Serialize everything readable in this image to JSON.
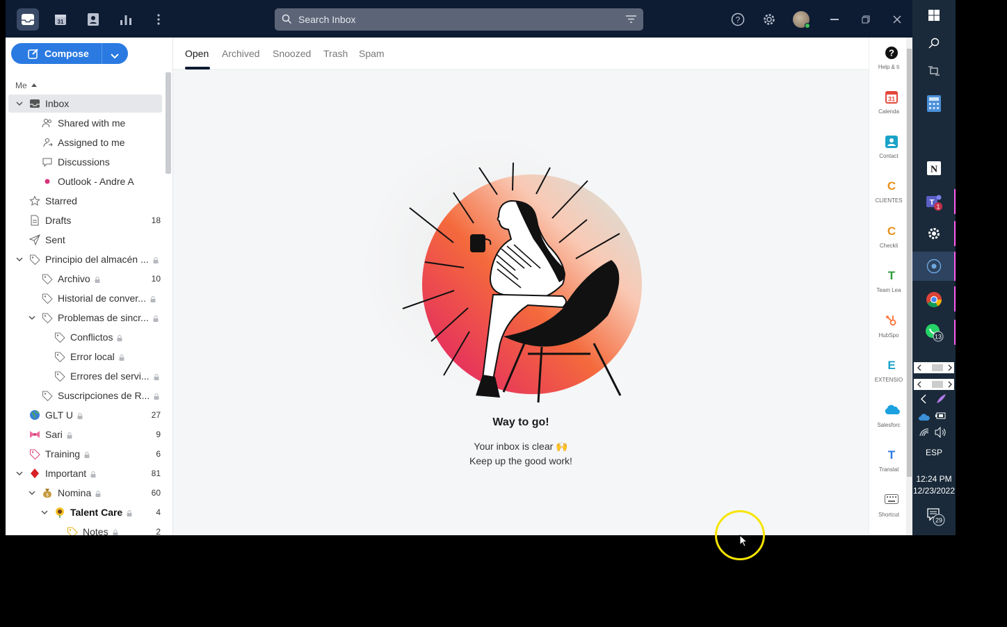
{
  "topbar": {
    "search_placeholder": "Search Inbox",
    "calendar_day": "31"
  },
  "compose": {
    "label": "Compose"
  },
  "nav": {
    "section": "Me",
    "items": [
      {
        "label": "Inbox",
        "count": ""
      },
      {
        "label": "Shared with me",
        "count": ""
      },
      {
        "label": "Assigned to me",
        "count": ""
      },
      {
        "label": "Discussions",
        "count": ""
      },
      {
        "label": "Outlook - Andre A",
        "count": ""
      },
      {
        "label": "Starred",
        "count": ""
      },
      {
        "label": "Drafts",
        "count": "18"
      },
      {
        "label": "Sent",
        "count": ""
      },
      {
        "label": "Principio del almacén ...",
        "count": ""
      },
      {
        "label": "Archivo",
        "count": "10"
      },
      {
        "label": "Historial de conver...",
        "count": ""
      },
      {
        "label": "Problemas de sincr...",
        "count": ""
      },
      {
        "label": "Conflictos",
        "count": ""
      },
      {
        "label": "Error local",
        "count": ""
      },
      {
        "label": "Errores del servi...",
        "count": ""
      },
      {
        "label": "Suscripciones de R...",
        "count": ""
      },
      {
        "label": "GLT U",
        "count": "27"
      },
      {
        "label": "Sari",
        "count": "9"
      },
      {
        "label": "Training",
        "count": "6"
      },
      {
        "label": "Important",
        "count": "81"
      },
      {
        "label": "Nomina",
        "count": "60"
      },
      {
        "label": "Talent Care",
        "count": "4"
      },
      {
        "label": "Notes",
        "count": "2"
      }
    ]
  },
  "tabs": [
    "Open",
    "Archived",
    "Snoozed",
    "Trash",
    "Spam"
  ],
  "empty_state": {
    "title": "Way to go!",
    "line1": "Your inbox is clear 🙌",
    "line2": "Keep up the good work!"
  },
  "right_apps": [
    {
      "label": "Help & ti",
      "glyph": "?",
      "color": "#111111"
    },
    {
      "label": "Calenda",
      "glyph": "31",
      "color": "#e2473b"
    },
    {
      "label": "Contact",
      "glyph": "",
      "color": "#1aa3c8"
    },
    {
      "label": "CLIENTES",
      "glyph": "C",
      "color": "#e8901a"
    },
    {
      "label": "Checkli",
      "glyph": "C",
      "color": "#e8901a"
    },
    {
      "label": "Team Lea",
      "glyph": "T",
      "color": "#2e9b3a"
    },
    {
      "label": "HubSpo",
      "glyph": "",
      "color": "#ff7a45"
    },
    {
      "label": "EXTENSIO",
      "glyph": "E",
      "color": "#1aa3c8"
    },
    {
      "label": "Salesforc",
      "glyph": "",
      "color": "#1ba0e0"
    },
    {
      "label": "Translat",
      "glyph": "T",
      "color": "#2a7ae2"
    },
    {
      "label": "Shortcut",
      "glyph": "",
      "color": "#666666"
    }
  ],
  "taskbar": {
    "teams_badge": "1",
    "whatsapp_badge": "13",
    "language": "ESP",
    "time": "12:24 PM",
    "date": "12/23/2022",
    "notifications": "29"
  }
}
